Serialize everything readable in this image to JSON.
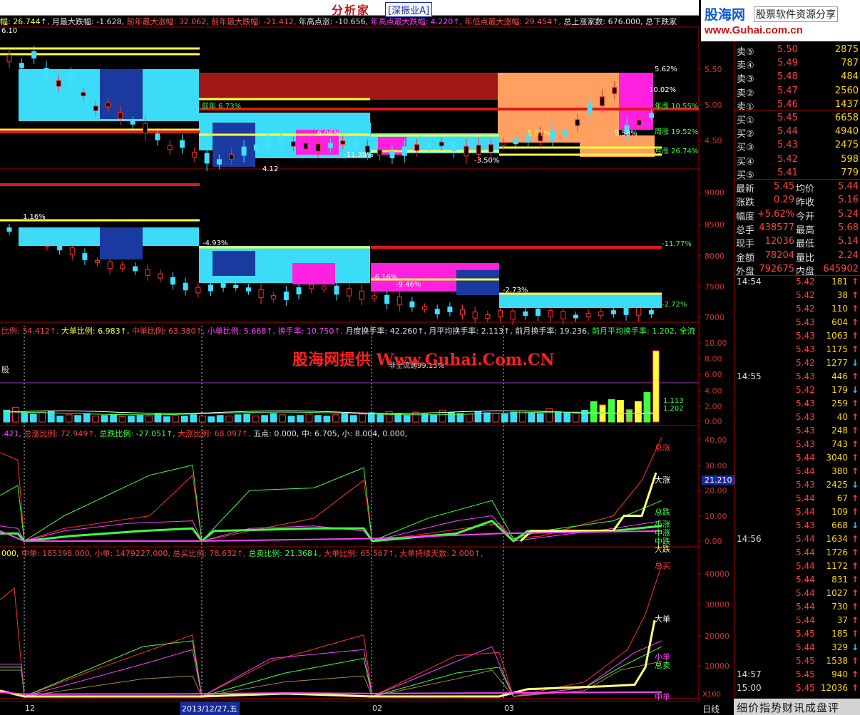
{
  "app": {
    "title": "分析家",
    "market_tab": "[深振业A]"
  },
  "logo": {
    "main": "股海网",
    "side": "股票软件资源分享",
    "url": "www.Guhai.com.cn"
  },
  "status": [
    {
      "t": "幅: 26.744",
      "c": "#ffff40"
    },
    {
      "t": "↑, 月最大跌幅: -1.628, ",
      "c": "#e0e0e0"
    },
    {
      "t": "前年最大涨幅: 32.062, 前年最大跌幅: -21.412, ",
      "c": "#ff5050"
    },
    {
      "t": "年高点涨: -10.656, ",
      "c": "#e0e0e0"
    },
    {
      "t": "年高点最大跌幅: 4.220↑, ",
      "c": "#ff40ff"
    },
    {
      "t": "年低点最大涨幅: 29.454↑, ",
      "c": "#ff5050"
    },
    {
      "t": "总上涨家数: 676.000, 总下跌家",
      "c": "#e0e0e0"
    }
  ],
  "watermark": "股海网提供 Www.Guhai.Com.CN",
  "info_lines": {
    "vol": [
      {
        "t": "比例: 34.412↑, ",
        "c": "#ff4040"
      },
      {
        "t": "大单比例: 6.983↑, ",
        "c": "#ffff40"
      },
      {
        "t": "中单比例: 63.380↑, ",
        "c": "#ff4040"
      },
      {
        "t": "小单比例: 5.668↑, ",
        "c": "#ff40ff"
      },
      {
        "t": "换手率: 10.750↑, ",
        "c": "#ff40ff"
      },
      {
        "t": "月度换手率: 42.260↑, 月平均换手率: 2.113↑, 前月换手率: 19.236, ",
        "c": "#e0e0e0"
      },
      {
        "t": "前月平均换手率: 1.202, 全流",
        "c": "#40ff40"
      }
    ],
    "ratio": [
      {
        "t": ".421, ",
        "c": "#ff40ff"
      },
      {
        "t": "总涨比例: 72.949↑, ",
        "c": "#ff4040"
      },
      {
        "t": "总跌比例: -27.051↑, ",
        "c": "#40ff40"
      },
      {
        "t": "大涨比例: 68.097↑, ",
        "c": "#ff4040"
      },
      {
        "t": "五点: 0.000, 中: 6.705, 小: 8.004, 0.000,",
        "c": "#e0e0e0"
      }
    ],
    "orders": [
      {
        "t": "000, ",
        "c": "#ffff40"
      },
      {
        "t": "中单: 185398.000, 小单: 1479227.000, 总买比例: 78.632↑, ",
        "c": "#ff4040"
      },
      {
        "t": "总卖比例: 21.368↓, ",
        "c": "#40ff40"
      },
      {
        "t": "大单比例: 65.567↑, 大单持续天数: 2.000↑,",
        "c": "#ff4040"
      }
    ]
  },
  "quote": {
    "asks": [
      {
        "label": "卖⑤",
        "price": "5.50",
        "vol": "2875"
      },
      {
        "label": "卖④",
        "price": "5.49",
        "vol": "787"
      },
      {
        "label": "卖③",
        "price": "5.48",
        "vol": "484"
      },
      {
        "label": "卖②",
        "price": "5.47",
        "vol": "2560"
      },
      {
        "label": "卖①",
        "price": "5.46",
        "vol": "1437"
      }
    ],
    "bids": [
      {
        "label": "买①",
        "price": "5.45",
        "vol": "6658"
      },
      {
        "label": "买②",
        "price": "5.44",
        "vol": "4940"
      },
      {
        "label": "买③",
        "price": "5.43",
        "vol": "2475"
      },
      {
        "label": "买④",
        "price": "5.42",
        "vol": "598"
      },
      {
        "label": "买⑤",
        "price": "5.41",
        "vol": "779"
      }
    ],
    "stats": [
      {
        "l1": "最新",
        "v1": "5.45",
        "l2": "均价",
        "v2": "5.44"
      },
      {
        "l1": "涨跌",
        "v1": "0.29",
        "l2": "昨收",
        "v2": "5.16"
      },
      {
        "l1": "幅度",
        "v1": "+5.62%",
        "l2": "今开",
        "v2": "5.24"
      },
      {
        "l1": "总手",
        "v1": "438577",
        "l2": "最高",
        "v2": "5.68"
      },
      {
        "l1": "现手",
        "v1": "12036",
        "l2": "最低",
        "v2": "5.14"
      },
      {
        "l1": "金额",
        "v1": "78204",
        "l2": "量比",
        "v2": "2.24"
      }
    ],
    "outer": {
      "l1": "外盘",
      "v1": "792675",
      "l2": "内盘",
      "v2": "645902"
    }
  },
  "ticks": [
    {
      "time": "14:54",
      "price": "5.42",
      "vol": "181",
      "dir": "up"
    },
    {
      "time": "",
      "price": "5.42",
      "vol": "38",
      "dir": "up"
    },
    {
      "time": "",
      "price": "5.42",
      "vol": "110",
      "dir": "up"
    },
    {
      "time": "",
      "price": "5.43",
      "vol": "604",
      "dir": "up"
    },
    {
      "time": "",
      "price": "5.43",
      "vol": "1063",
      "dir": "up"
    },
    {
      "time": "",
      "price": "5.43",
      "vol": "1175",
      "dir": "up"
    },
    {
      "time": "",
      "price": "5.42",
      "vol": "1277",
      "dir": "down"
    },
    {
      "time": "14:55",
      "price": "5.43",
      "vol": "446",
      "dir": "up"
    },
    {
      "time": "",
      "price": "5.42",
      "vol": "179",
      "dir": "down"
    },
    {
      "time": "",
      "price": "5.43",
      "vol": "259",
      "dir": "up"
    },
    {
      "time": "",
      "price": "5.43",
      "vol": "40",
      "dir": "up"
    },
    {
      "time": "",
      "price": "5.43",
      "vol": "248",
      "dir": "up"
    },
    {
      "time": "",
      "price": "5.43",
      "vol": "743",
      "dir": "up"
    },
    {
      "time": "",
      "price": "5.44",
      "vol": "3040",
      "dir": "up"
    },
    {
      "time": "",
      "price": "5.44",
      "vol": "380",
      "dir": "up"
    },
    {
      "time": "",
      "price": "5.43",
      "vol": "2425",
      "dir": "down"
    },
    {
      "time": "",
      "price": "5.44",
      "vol": "67",
      "dir": "up"
    },
    {
      "time": "",
      "price": "5.44",
      "vol": "109",
      "dir": "up"
    },
    {
      "time": "",
      "price": "5.43",
      "vol": "668",
      "dir": "down"
    },
    {
      "time": "14:56",
      "price": "5.44",
      "vol": "1634",
      "dir": "up"
    },
    {
      "time": "",
      "price": "5.44",
      "vol": "1726",
      "dir": "up"
    },
    {
      "time": "",
      "price": "5.44",
      "vol": "1172",
      "dir": "up"
    },
    {
      "time": "",
      "price": "5.44",
      "vol": "831",
      "dir": "up"
    },
    {
      "time": "",
      "price": "5.44",
      "vol": "1027",
      "dir": "up"
    },
    {
      "time": "",
      "price": "5.44",
      "vol": "730",
      "dir": "up"
    },
    {
      "time": "",
      "price": "5.44",
      "vol": "37",
      "dir": "up"
    },
    {
      "time": "",
      "price": "5.45",
      "vol": "185",
      "dir": "up"
    },
    {
      "time": "",
      "price": "5.44",
      "vol": "329",
      "dir": "down"
    },
    {
      "time": "",
      "price": "5.45",
      "vol": "1538",
      "dir": "up"
    },
    {
      "time": "14:57",
      "price": "5.45",
      "vol": "940",
      "dir": "up"
    },
    {
      "time": "15:00",
      "price": "5.45",
      "vol": "12036",
      "dir": "up"
    }
  ],
  "tabs": "细价指势财讯成盘评",
  "x_axis": {
    "labels": [
      "12",
      "02",
      "03"
    ],
    "cursor_date": "2013/12/27,五",
    "period": "日线"
  },
  "cursor_value": "21.210",
  "chart_data": [
    {
      "type": "candlestick",
      "name": "price",
      "yticks": [
        "5.50",
        "5.00",
        "4.50"
      ],
      "ylim": [
        4.1,
        5.8
      ],
      "annotations": [
        "6.10",
        "5.62%",
        "10.02%",
        "前年 6.73%",
        "年涨 10.55%",
        "周涨 19.52%",
        "月涨 26.74%",
        "6.06%",
        "5.81%",
        "5.58%",
        "-11.38%",
        "-3.50%",
        "4.12"
      ]
    },
    {
      "type": "candlestick",
      "name": "index",
      "yticks": [
        "9000",
        "8500",
        "8000",
        "7500",
        "7000"
      ],
      "ylim": [
        6800,
        9300
      ],
      "annotations": [
        "1.16%",
        "-4.93%",
        "-6.16%",
        "-2.73%",
        "-11.77%",
        "-2.72%",
        "-9.46%"
      ]
    },
    {
      "type": "bar",
      "name": "turnover",
      "yticks": [
        "10.00",
        "8.00",
        "6.00",
        "4.00",
        "2.00",
        "0.00"
      ],
      "ylim": [
        0,
        12
      ],
      "values": [
        1.8,
        2.2,
        1.4,
        1.2,
        1.5,
        1.6,
        0.9,
        1.1,
        1.0,
        1.3,
        0.9,
        1.0,
        1.1,
        0.8,
        0.9,
        1.0,
        0.9,
        1.2,
        0.8,
        1.0,
        0.9,
        1.1,
        0.9,
        0.8,
        1.0,
        0.9,
        1.1,
        1.2,
        0.9,
        1.0,
        1.3,
        1.1,
        0.9,
        1.0,
        1.2,
        1.0,
        0.9,
        1.1,
        1.3,
        1.0,
        1.2,
        1.4,
        1.1,
        1.6,
        1.3,
        1.0,
        1.5,
        1.2,
        1.1,
        1.8,
        1.4,
        1.3,
        1.2,
        1.6,
        1.4,
        1.3,
        1.2,
        1.5,
        1.7,
        1.4,
        1.3,
        2.0,
        1.6,
        1.4,
        1.3,
        1.8,
        3.1,
        2.6,
        3.4,
        3.3,
        1.9,
        3.1,
        4.5,
        10.8
      ],
      "annotations": [
        "非全流通99.15%",
        "1.113",
        "1.202"
      ]
    },
    {
      "type": "line",
      "name": "ratio",
      "yticks": [
        "40.00",
        "30.00",
        "20.00",
        "10.00",
        "0.00"
      ],
      "ylim": [
        0,
        45
      ],
      "labels": [
        "总涨",
        "大涨",
        "总跌",
        "小涨",
        "中涨",
        "中跌",
        "大跌"
      ]
    },
    {
      "type": "line",
      "name": "orders",
      "yticks": [
        "40000",
        "30000",
        "20000",
        "10000"
      ],
      "ylim": [
        0,
        48000
      ],
      "labels": [
        "总买",
        "大单",
        "小单",
        "总卖",
        "中单"
      ],
      "scale": "X100"
    }
  ]
}
